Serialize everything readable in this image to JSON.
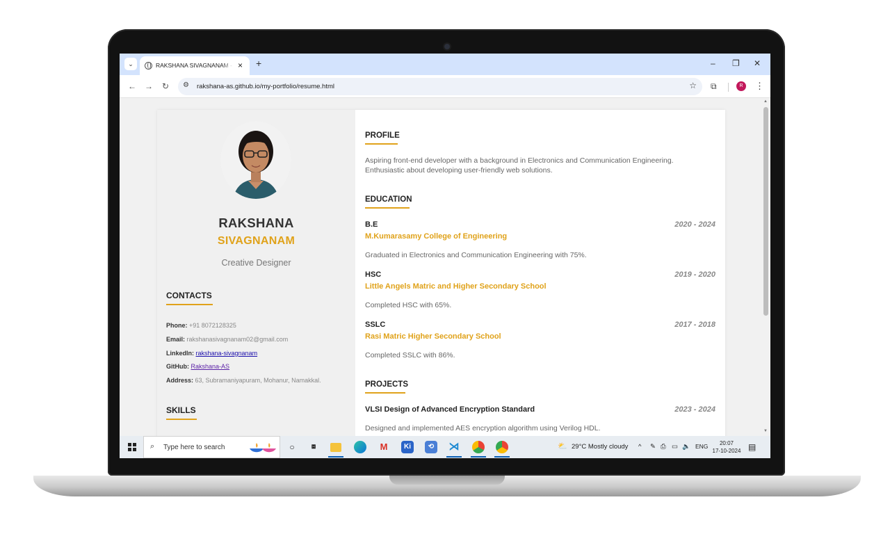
{
  "browser": {
    "tab_menu_icon": "chevron-down-icon",
    "tab_title": "RAKSHANA SIVAGNANAM - Resume",
    "tab_close": "×",
    "new_tab": "+",
    "window_minimize": "–",
    "window_restore": "❐",
    "window_close": "✕",
    "url": "rakshana-as.github.io/my-portfolio/resume.html",
    "profile_initial": "R"
  },
  "resume": {
    "first_name": "RAKSHANA",
    "last_name": "SIVAGNANAM",
    "role": "Creative Designer",
    "contacts_heading": "CONTACTS",
    "contacts": {
      "phone_label": "Phone:",
      "phone": "+91 8072128325",
      "email_label": "Email:",
      "email": "rakshanasivagnanam02@gmail.com",
      "linkedin_label": "LinkedIn:",
      "linkedin": "rakshana-sivagnanam",
      "github_label": "GitHub:",
      "github": "Rakshana-AS",
      "address_label": "Address:",
      "address": "63, Subramaniyapuram, Mohanur, Namakkal."
    },
    "skills_heading": "SKILLS",
    "profile_heading": "PROFILE",
    "profile_line1": "Aspiring front-end developer with a background in Electronics and Communication Engineering.",
    "profile_line2": "Enthusiastic about developing user-friendly web solutions.",
    "education_heading": "EDUCATION",
    "education": [
      {
        "degree": "B.E",
        "years": "2020 - 2024",
        "institution": "M.Kumarasamy College of Engineering",
        "detail": "Graduated in Electronics and Communication Engineering with 75%."
      },
      {
        "degree": "HSC",
        "years": "2019 - 2020",
        "institution": "Little Angels Matric and Higher Secondary School",
        "detail": "Completed HSC with 65%."
      },
      {
        "degree": "SSLC",
        "years": "2017 - 2018",
        "institution": "Rasi Matric Higher Secondary School",
        "detail": "Completed SSLC with 86%."
      }
    ],
    "projects_heading": "PROJECTS",
    "projects": [
      {
        "title": "VLSI Design of Advanced Encryption Standard",
        "years": "2023 - 2024",
        "detail": "Designed and implemented AES encryption algorithm using Verilog HDL."
      }
    ]
  },
  "taskbar": {
    "search_placeholder": "Type here to search",
    "weather": "29°C  Mostly cloudy",
    "language": "ENG",
    "time": "20:07",
    "date": "17-10-2024",
    "pinned_apps": [
      "task-view-icon",
      "file-explorer-icon",
      "edge-icon",
      "gmail-icon",
      "kite-icon",
      "app-icon",
      "vscode-icon",
      "chrome-canary-icon",
      "chrome-icon"
    ]
  }
}
